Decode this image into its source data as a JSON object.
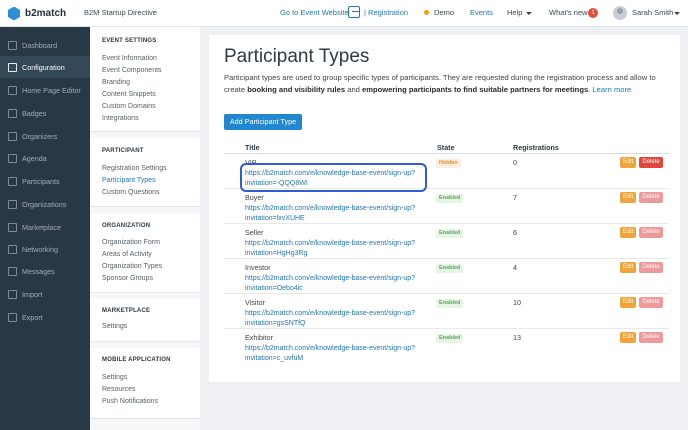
{
  "topbar": {
    "brand": "b2match",
    "event_title": "B2M Startup Directive",
    "goto_event": "Go to Event Website",
    "registration": "| Registration",
    "demo": "Demo",
    "events": "Events",
    "help": "Help",
    "whats_new": "What's new",
    "whats_new_count": "1",
    "user_name": "Sarah Smith"
  },
  "sidenav": {
    "items": [
      {
        "label": "Dashboard",
        "icon": "dashboard-icon"
      },
      {
        "label": "Configuration",
        "icon": "gear-icon",
        "active": true
      },
      {
        "label": "Home Page Editor",
        "icon": "page-icon"
      },
      {
        "label": "Badges",
        "icon": "badge-icon"
      },
      {
        "label": "Organizers",
        "icon": "users-icon"
      },
      {
        "label": "Agenda",
        "icon": "calendar-icon"
      },
      {
        "label": "Participants",
        "icon": "user-icon"
      },
      {
        "label": "Organizations",
        "icon": "building-icon"
      },
      {
        "label": "Marketplace",
        "icon": "store-icon"
      },
      {
        "label": "Networking",
        "icon": "handshake-icon"
      },
      {
        "label": "Messages",
        "icon": "mail-icon"
      },
      {
        "label": "Import",
        "icon": "import-icon"
      },
      {
        "label": "Export",
        "icon": "export-icon"
      }
    ]
  },
  "settings": {
    "event_settings": {
      "heading": "EVENT SETTINGS",
      "links": [
        "Event Information",
        "Event Components",
        "Branding",
        "Content Snippets",
        "Custom Domains",
        "Integrations"
      ]
    },
    "participant": {
      "heading": "PARTICIPANT",
      "links": [
        "Registration Settings",
        "Participant Types",
        "Custom Questions"
      ]
    },
    "organization": {
      "heading": "ORGANIZATION",
      "links": [
        "Organization Form",
        "Areas of Activity",
        "Organization Types",
        "Sponsor Groups"
      ]
    },
    "marketplace": {
      "heading": "MARKETPLACE",
      "links": [
        "Settings"
      ]
    },
    "mobile": {
      "heading": "MOBILE APPLICATION",
      "links": [
        "Settings",
        "Resources",
        "Push Notifications"
      ]
    }
  },
  "main": {
    "title": "Participant Types",
    "intro_1": "Participant types are used to group specific types of participants. They are requested during the registration process and allow to create ",
    "intro_b1": "booking and visibility rules",
    "intro_2": " and ",
    "intro_b2": "empowering participants to find suitable partners for meetings",
    "intro_3": ". ",
    "learn_more": "Learn more",
    "add_button": "Add Participant Type",
    "columns": {
      "title": "Title",
      "state": "State",
      "registrations": "Registrations"
    },
    "edit_label": "Edit",
    "delete_label": "Delete",
    "rows": [
      {
        "title": "VIP",
        "link1": "https://b2match.com/e/knowledge-base-event/sign-up?",
        "link2": "invitation=-QQQ8WI",
        "state": "Hidden",
        "registrations": "0"
      },
      {
        "title": "Buyer",
        "link1": "https://b2match.com/e/knowledge-base-event/sign-up?",
        "link2": "invitation=lxvXUHE",
        "state": "Enabled",
        "registrations": "7"
      },
      {
        "title": "Seller",
        "link1": "https://b2match.com/e/knowledge-base-event/sign-up?",
        "link2": "invitation=HgHg3Rg",
        "state": "Enabled",
        "registrations": "6"
      },
      {
        "title": "Investor",
        "link1": "https://b2match.com/e/knowledge-base-event/sign-up?",
        "link2": "invitation=Oebo4ic",
        "state": "Enabled",
        "registrations": "4"
      },
      {
        "title": "Visitor",
        "link1": "https://b2match.com/e/knowledge-base-event/sign-up?",
        "link2": "invitation=gsSNTfQ",
        "state": "Enabled",
        "registrations": "10"
      },
      {
        "title": "Exhibitor",
        "link1": "https://b2match.com/e/knowledge-base-event/sign-up?",
        "link2": "invitation=c_uvfuM",
        "state": "Enabled",
        "registrations": "13"
      }
    ]
  },
  "colors": {
    "accent": "#2386d1",
    "sidebar": "#283845",
    "edit": "#f0a43a",
    "delete": "#e0463b",
    "highlight": "#2f5ad8"
  }
}
